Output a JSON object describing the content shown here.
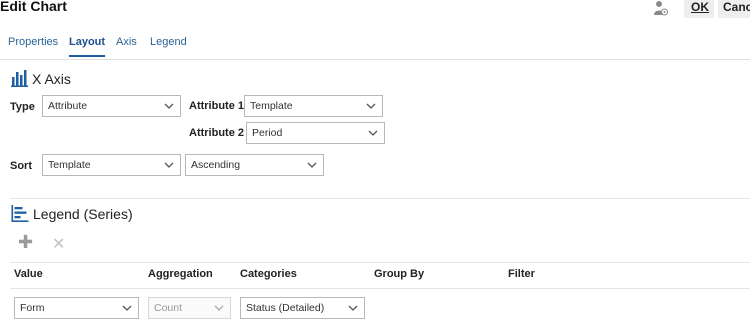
{
  "header": {
    "title": "Edit Chart",
    "ok_label": "OK",
    "cancel_label": "Cance"
  },
  "tabs": [
    {
      "label": "Properties",
      "active": false
    },
    {
      "label": "Layout",
      "active": true
    },
    {
      "label": "Axis",
      "active": false
    },
    {
      "label": "Legend",
      "active": false
    }
  ],
  "x_axis": {
    "title": "X Axis",
    "type_label": "Type",
    "type_value": "Attribute",
    "attribute1_label": "Attribute 1",
    "attribute1_value": "Template",
    "attribute2_label": "Attribute 2",
    "attribute2_value": "Period",
    "sort_label": "Sort",
    "sort_value": "Template",
    "sort_order_value": "Ascending"
  },
  "legend": {
    "title": "Legend (Series)",
    "columns": [
      "Value",
      "Aggregation",
      "Categories",
      "Group By",
      "Filter"
    ],
    "row": {
      "value": "Form",
      "aggregation": "Count",
      "categories": "Status (Detailed)"
    }
  },
  "colors": {
    "accent": "#1d5fa0",
    "link": "#2a6496"
  }
}
